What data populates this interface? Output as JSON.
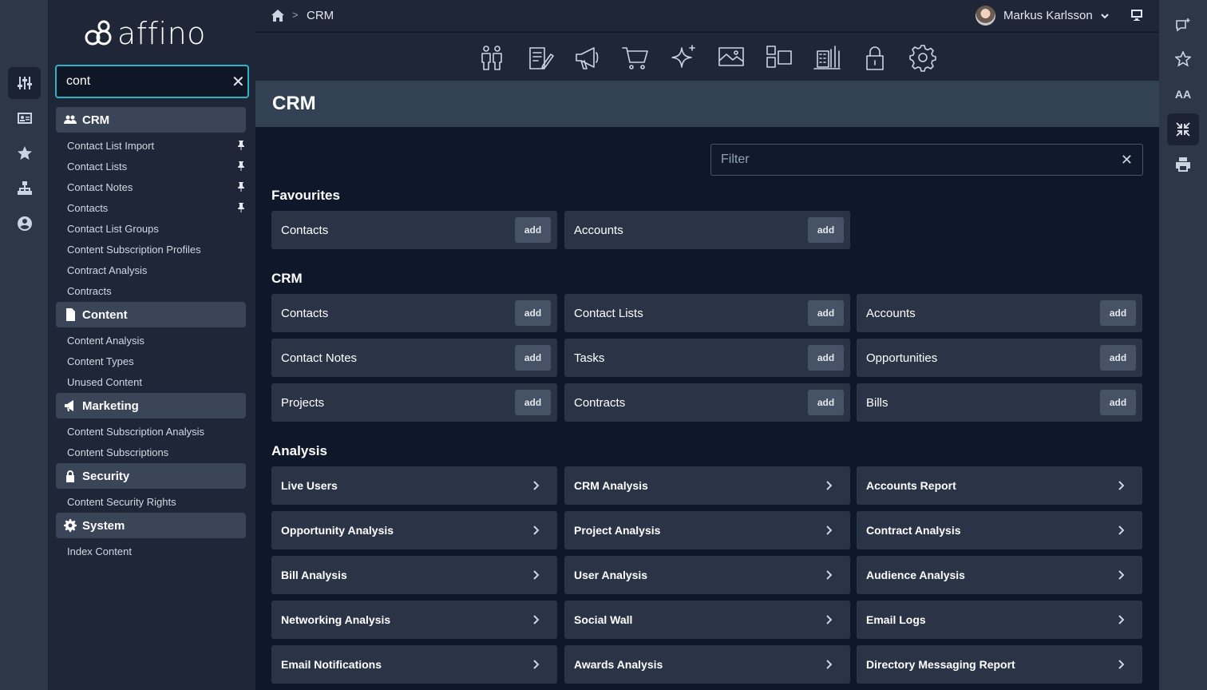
{
  "brand": {
    "logo_text": "affino"
  },
  "search": {
    "value": "cont",
    "clear_icon": "close-icon"
  },
  "breadcrumb": {
    "current": "CRM",
    "separator": ">"
  },
  "user": {
    "name": "Markus Karlsson"
  },
  "page": {
    "title": "CRM"
  },
  "filter": {
    "placeholder": "Filter",
    "value": ""
  },
  "nav": {
    "groups": [
      {
        "label": "CRM",
        "icon": "users-icon",
        "items": [
          {
            "label": "Contact List Import",
            "pinned": true
          },
          {
            "label": "Contact Lists",
            "pinned": true
          },
          {
            "label": "Contact Notes",
            "pinned": true
          },
          {
            "label": "Contacts",
            "pinned": true
          },
          {
            "label": "Contact List Groups",
            "pinned": false
          },
          {
            "label": "Content Subscription Profiles",
            "pinned": false
          },
          {
            "label": "Contract Analysis",
            "pinned": false
          },
          {
            "label": "Contracts",
            "pinned": false
          }
        ]
      },
      {
        "label": "Content",
        "icon": "document-icon",
        "items": [
          {
            "label": "Content Analysis"
          },
          {
            "label": "Content Types"
          },
          {
            "label": "Unused Content"
          }
        ]
      },
      {
        "label": "Marketing",
        "icon": "megaphone-icon",
        "items": [
          {
            "label": "Content Subscription Analysis"
          },
          {
            "label": "Content Subscriptions"
          }
        ]
      },
      {
        "label": "Security",
        "icon": "lock-icon",
        "items": [
          {
            "label": "Content Security Rights"
          }
        ]
      },
      {
        "label": "System",
        "icon": "gear-icon",
        "items": [
          {
            "label": "Index Content"
          }
        ]
      }
    ]
  },
  "sections": {
    "favourites": {
      "title": "Favourites",
      "cards": [
        {
          "label": "Contacts",
          "action": "add"
        },
        {
          "label": "Accounts",
          "action": "add"
        }
      ]
    },
    "crm": {
      "title": "CRM",
      "cards": [
        {
          "label": "Contacts",
          "action": "add"
        },
        {
          "label": "Contact Lists",
          "action": "add"
        },
        {
          "label": "Accounts",
          "action": "add"
        },
        {
          "label": "Contact Notes",
          "action": "add"
        },
        {
          "label": "Tasks",
          "action": "add"
        },
        {
          "label": "Opportunities",
          "action": "add"
        },
        {
          "label": "Projects",
          "action": "add"
        },
        {
          "label": "Contracts",
          "action": "add"
        },
        {
          "label": "Bills",
          "action": "add"
        }
      ]
    },
    "analysis": {
      "title": "Analysis",
      "cards": [
        {
          "label": "Live Users"
        },
        {
          "label": "CRM Analysis"
        },
        {
          "label": "Accounts Report"
        },
        {
          "label": "Opportunity Analysis"
        },
        {
          "label": "Project Analysis"
        },
        {
          "label": "Contract Analysis"
        },
        {
          "label": "Bill Analysis"
        },
        {
          "label": "User Analysis"
        },
        {
          "label": "Audience Analysis"
        },
        {
          "label": "Networking Analysis"
        },
        {
          "label": "Social Wall"
        },
        {
          "label": "Email Logs"
        },
        {
          "label": "Email Notifications"
        },
        {
          "label": "Awards Analysis"
        },
        {
          "label": "Directory Messaging Report"
        }
      ]
    }
  },
  "right_rail": {
    "text_size_label": "AA"
  },
  "colors": {
    "accent": "#2cb3c4",
    "card": "#2a3446",
    "heading": "#334155"
  }
}
